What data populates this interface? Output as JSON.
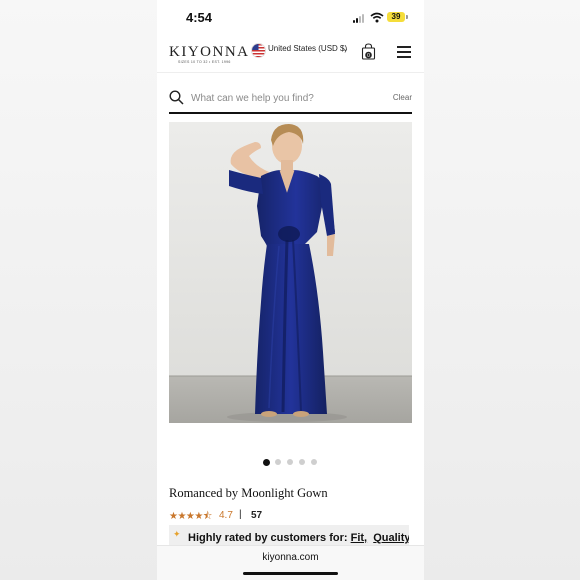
{
  "status_bar": {
    "time": "4:54",
    "battery": "39"
  },
  "header": {
    "logo": "KIYONNA",
    "logo_tagline": "SIZES 10 TO 32 • EST. 1996",
    "country_selector": "United States (USD $)",
    "cart_count": "0"
  },
  "search": {
    "placeholder": "What can we help you find?",
    "clear_label": "Clear"
  },
  "carousel": {
    "slide_count": 5,
    "active_index": 0
  },
  "product": {
    "title": "Romanced by Moonlight Gown",
    "rating": "4.7",
    "rating_separator": "|",
    "review_count": "57",
    "rating_stars_fraction": 0.94,
    "banner_prefix": "Highly rated by customers for:",
    "banner_link_1": "Fit,",
    "banner_link_2": "Quality"
  },
  "browser": {
    "url": "kiyonna.com"
  },
  "colors": {
    "accent_star": "#c9772c",
    "gown": "#1b2e86",
    "banner_bg": "#efefef"
  }
}
